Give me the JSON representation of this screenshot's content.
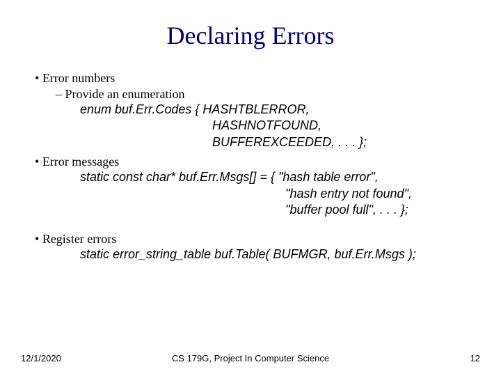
{
  "title": "Declaring Errors",
  "bullets": {
    "b1": "Error numbers",
    "b1a": "Provide an enumeration",
    "code1": "enum buf.Err.Codes { HASHTBLERROR,\n                                      HASHNOTFOUND,\n                                      BUFFEREXCEEDED, . . . };",
    "b2": "Error messages",
    "code2": "static const char* buf.Err.Msgs[] = { \"hash table error\",\n                                                           \"hash entry not found\",\n                                                           \"buffer pool full\", . . . };",
    "b3": "Register errors",
    "code3": "static error_string_table buf.Table( BUFMGR, buf.Err.Msgs );"
  },
  "footer": {
    "date": "12/1/2020",
    "center": "CS 179G, Project In Computer\nScience",
    "page": "12"
  }
}
